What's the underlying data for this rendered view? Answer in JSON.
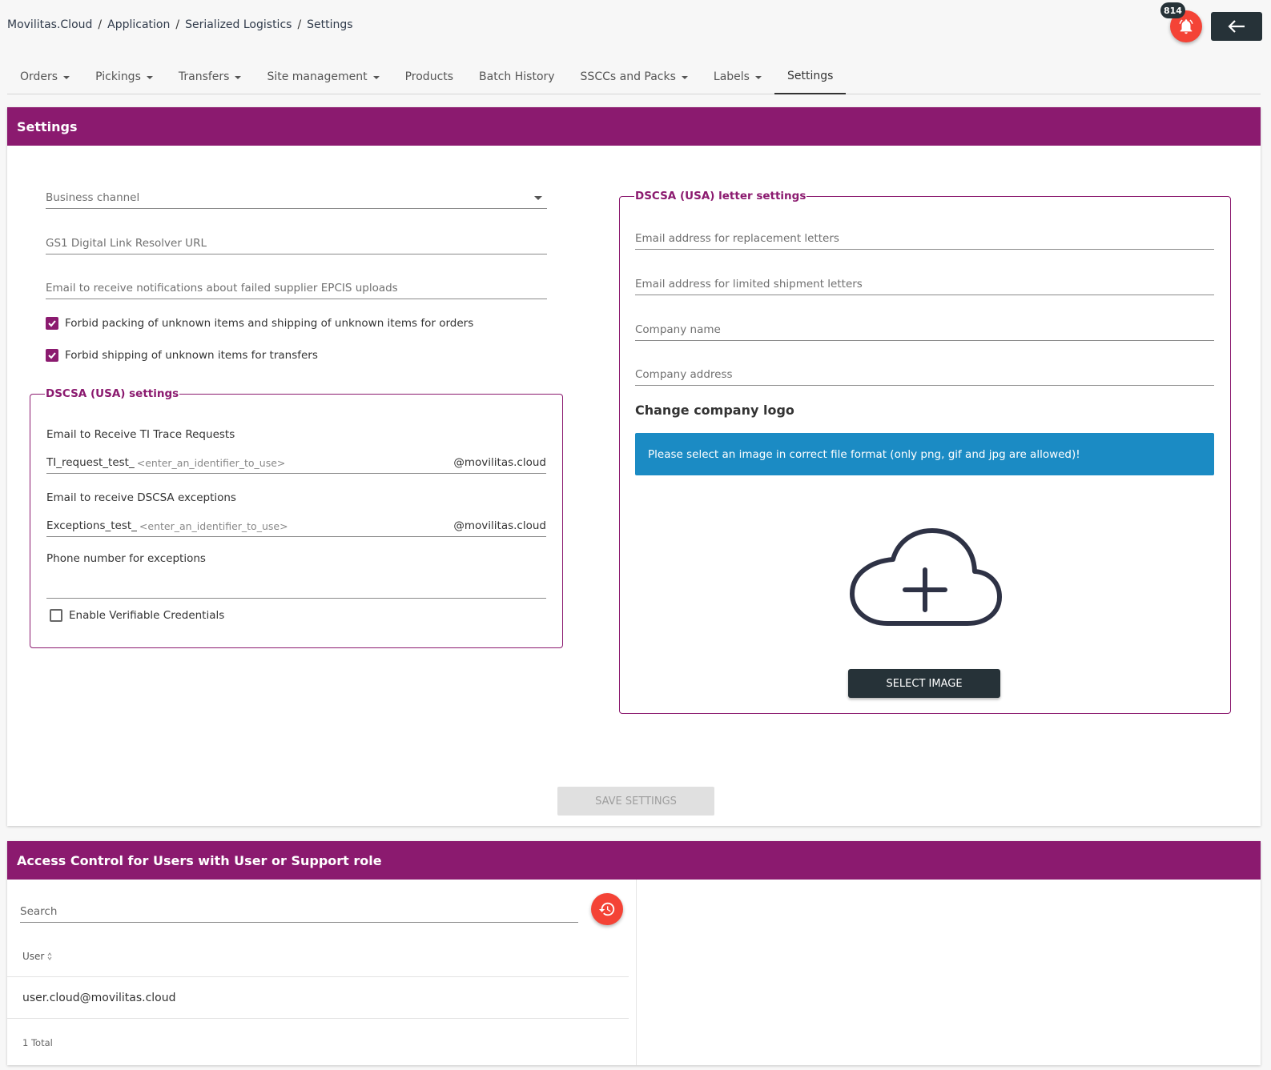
{
  "breadcrumb": [
    "Movilitas.Cloud",
    "Application",
    "Serialized Logistics",
    "Settings"
  ],
  "notifications": {
    "count": "814",
    "icon": "bell-icon"
  },
  "header": {
    "back_icon": "arrow-left-icon"
  },
  "tabs": [
    {
      "label": "Orders",
      "dropdown": true
    },
    {
      "label": "Pickings",
      "dropdown": true
    },
    {
      "label": "Transfers",
      "dropdown": true
    },
    {
      "label": "Site management",
      "dropdown": true
    },
    {
      "label": "Products",
      "dropdown": false
    },
    {
      "label": "Batch History",
      "dropdown": false
    },
    {
      "label": "SSCCs and Packs",
      "dropdown": true
    },
    {
      "label": "Labels",
      "dropdown": true
    },
    {
      "label": "Settings",
      "dropdown": false,
      "active": true
    }
  ],
  "settings": {
    "title": "Settings",
    "business_channel": "Business channel",
    "gs1_url": "GS1 Digital Link Resolver URL",
    "epcis_email": "Email to receive notifications about failed supplier EPCIS uploads",
    "forbid_packing": {
      "label": "Forbid packing of unknown items and shipping of unknown items for orders",
      "checked": true
    },
    "forbid_shipping": {
      "label": "Forbid shipping of unknown items for transfers",
      "checked": true
    },
    "dscsa": {
      "legend": "DSCSA (USA) settings",
      "ti_label": "Email to Receive TI Trace Requests",
      "ti_prefix": "TI_request_test_",
      "ti_placeholder": "<enter_an_identifier_to_use>",
      "ti_suffix": "@movilitas.cloud",
      "exc_label": "Email to receive DSCSA exceptions",
      "exc_prefix": "Exceptions_test_",
      "exc_placeholder": "<enter_an_identifier_to_use>",
      "exc_suffix": "@movilitas.cloud",
      "phone_label": "Phone number for exceptions",
      "vc": {
        "label": "Enable Verifiable Credentials",
        "checked": false
      }
    },
    "letter": {
      "legend": "DSCSA (USA) letter settings",
      "replacement_email": "Email address for replacement letters",
      "limited_email": "Email address for limited shipment letters",
      "company_name": "Company name",
      "company_address": "Company address",
      "logo_title": "Change company logo",
      "info": "Please select an image in correct file format (only png, gif and jpg are allowed)!",
      "upload_icon": "cloud-upload-icon",
      "select_button": "SELECT IMAGE"
    },
    "save_button": "SAVE SETTINGS"
  },
  "access": {
    "title": "Access Control for Users with User or Support role",
    "search_placeholder": "Search",
    "history_icon": "history-icon",
    "column": "User",
    "rows": [
      "user.cloud@movilitas.cloud"
    ],
    "total": "1 Total"
  },
  "colors": {
    "primary": "#8b1a6f",
    "info": "#1b8bc4",
    "danger": "#f44336",
    "dark": "#263238"
  }
}
